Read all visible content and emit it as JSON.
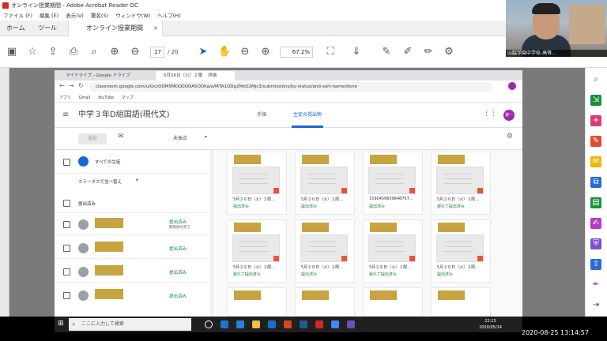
{
  "acrobat": {
    "title": "オンライン授業期間 - Adobe Acrobat Reader DC",
    "menu": [
      "ファイル (F)",
      "編集 (E)",
      "表示(V)",
      "署名(S)",
      "ウィンドウ(W)",
      "ヘルプ(H)"
    ],
    "tabs": [
      "ホーム",
      "ツール"
    ],
    "doc_tab": "オンライン授業期間",
    "page_current": "17",
    "page_total": "/ 20",
    "zoom": "67.2%"
  },
  "browser": {
    "tab1": "マイドライブ - Google ドライブ",
    "tab2": "5月26日（火）２限 　評価",
    "url": "classroom.google.com/u/0/c/ODM5MDQ0ODA5ODha/a/MTA1ODg2MzQ2Mjc3/submissions/by-status/and-sort-name/done",
    "bookmarks": [
      "アプリ",
      "Gmail",
      "YouTube",
      "マップ"
    ]
  },
  "classroom": {
    "title": "中学３年D組国語(現代文)",
    "tab_instructions": "手順",
    "tab_submissions": "生徒の提出物",
    "avatar": "渡一",
    "return_btn": "返却",
    "sort_label": "未採点",
    "all_students": "すべての生徒",
    "sort_by_status": "ステータスで並べ替え",
    "section_submitted": "提出済み",
    "students": [
      {
        "status": "提出済み",
        "sub": "期限後の完了"
      },
      {
        "status": "提出済み",
        "sub": ""
      },
      {
        "status": "提出済み",
        "sub": ""
      },
      {
        "status": "提出済み",
        "sub": ""
      }
    ],
    "cards": [
      {
        "file": "5月２６日（火）２限...",
        "status": "提出済み"
      },
      {
        "file": "5月２６日（火）２限...",
        "status": "提出済み"
      },
      {
        "file": "1590456659648767...",
        "status": "提出済み"
      },
      {
        "file": "5月２６日（火）２限...",
        "status": "遅れて提出済み"
      },
      {
        "file": "5月２６日（火）２限...",
        "status": "遅れて提出済み"
      },
      {
        "file": "5月２６日（火）２限...",
        "status": "提出済み"
      },
      {
        "file": "5月２６日（火）２限...",
        "status": "遅れて提出済み"
      },
      {
        "file": "5月２６日（火）２限...",
        "status": "提出済み"
      }
    ]
  },
  "taskbar": {
    "search": "ここに入力して検索",
    "time": "22:15",
    "date": "2020/05/14"
  },
  "webcam_label": "山脇学園中学校-高等...",
  "timestamp": "2020-08-25  13:14:57"
}
